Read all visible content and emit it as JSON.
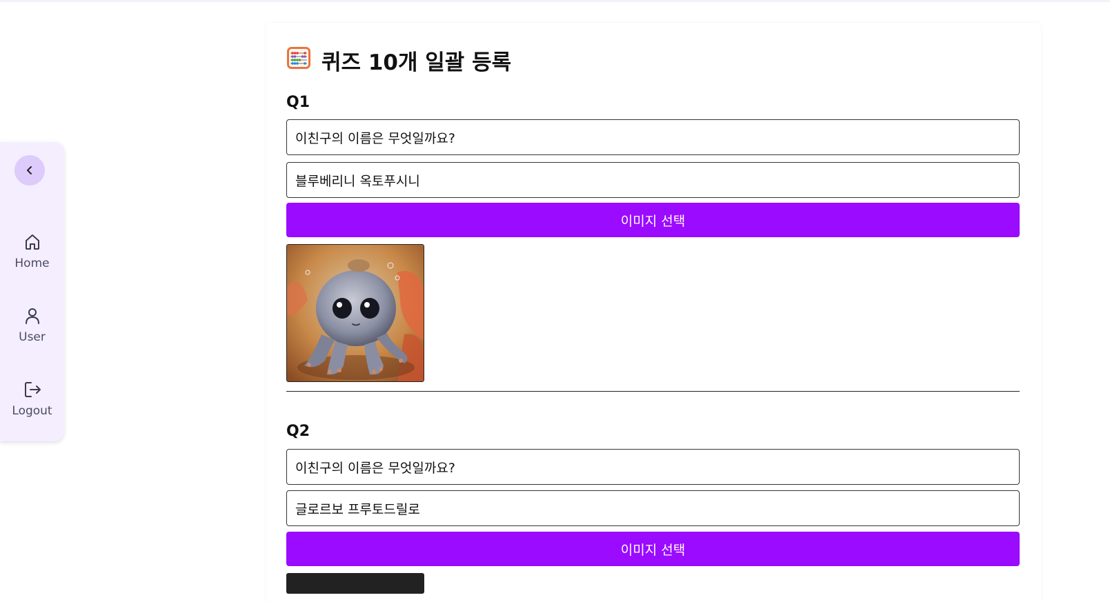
{
  "sidebar": {
    "collapse_icon": "chevron-left-icon",
    "items": [
      {
        "label": "Home",
        "icon": "home-icon"
      },
      {
        "label": "User",
        "icon": "user-icon"
      },
      {
        "label": "Logout",
        "icon": "logout-icon"
      }
    ]
  },
  "page": {
    "title": "퀴즈 10개 일괄 등록",
    "title_icon": "abacus-icon"
  },
  "quizzes": [
    {
      "label": "Q1",
      "question": "이친구의 이름은 무엇일까요?",
      "answer": "블루베리니 옥토푸시니",
      "image_button": "이미지 선택",
      "image": "octopus-character-image"
    },
    {
      "label": "Q2",
      "question": "이친구의 이름은 무엇일까요?",
      "answer": "글로르보 프루토드릴로",
      "image_button": "이미지 선택"
    }
  ],
  "colors": {
    "accent": "#9b0bff",
    "sidebar_bg": "#f4eefe",
    "collapse_bg": "#dccbfb"
  }
}
